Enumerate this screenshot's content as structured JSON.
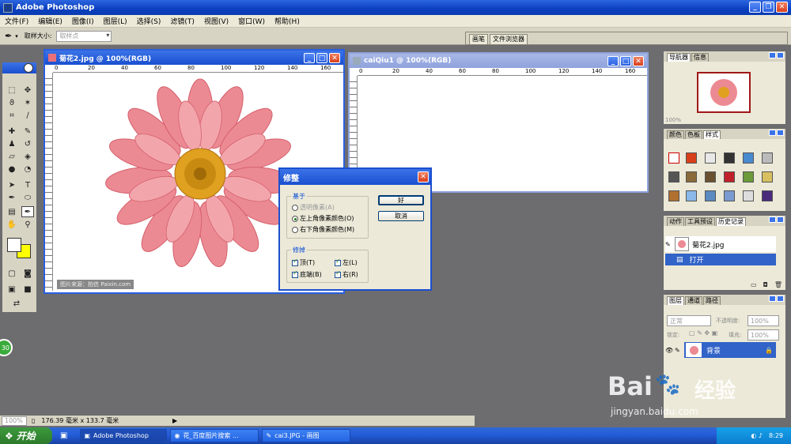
{
  "app": {
    "title": "Adobe Photoshop"
  },
  "menu": [
    "文件(F)",
    "编辑(E)",
    "图像(I)",
    "图层(L)",
    "选择(S)",
    "滤镜(T)",
    "视图(V)",
    "窗口(W)",
    "帮助(H)"
  ],
  "options": {
    "sample_label": "取样大小:",
    "sample_value": "取样点"
  },
  "wells": [
    "画笔",
    "文件浏览器"
  ],
  "doc1": {
    "title": "菊花2.jpg @ 100%(RGB)",
    "ruler_ticks": [
      "0",
      "20",
      "40",
      "60",
      "80",
      "100",
      "120",
      "140",
      "160"
    ],
    "watermark": "图片来源：拍信 Paixin.com"
  },
  "doc2": {
    "title": "caiQiu1 @ 100%(RGB)",
    "ruler_ticks": [
      "0",
      "20",
      "40",
      "60",
      "80",
      "100",
      "120",
      "140",
      "160"
    ]
  },
  "dialog": {
    "title": "修整",
    "based_on_label": "基于",
    "opt_transparent": "透明像素(A)",
    "opt_topleft": "左上角像素颜色(O)",
    "opt_bottomright": "右下角像素颜色(M)",
    "trim_label": "修掉",
    "chk_top": "顶(T)",
    "chk_left": "左(L)",
    "chk_bottom": "底端(B)",
    "chk_right": "右(R)",
    "ok": "好",
    "cancel": "取消"
  },
  "navigator": {
    "tabs": [
      "导航器",
      "信息"
    ],
    "zoom": "100%"
  },
  "color_panel": {
    "tabs": [
      "颜色",
      "色板",
      "样式"
    ]
  },
  "history": {
    "tabs": [
      "动作",
      "工具预设",
      "历史记录"
    ],
    "snapshot": "菊花2.jpg",
    "step": "打开"
  },
  "layers": {
    "tabs": [
      "图层",
      "通道",
      "路径"
    ],
    "blend": "正常",
    "opacity_label": "不透明度:",
    "opacity": "100%",
    "lock_label": "锁定:",
    "fill_label": "填充:",
    "fill": "100%",
    "layer_name": "背景"
  },
  "status": {
    "zoom": "100%",
    "size": "176.39 毫米 x 133.7 毫米"
  },
  "taskbar": {
    "start": "开始",
    "items": [
      "Adobe Photoshop",
      "花_百度图片搜索 ...",
      "cai3.JPG - 画图"
    ],
    "time": "8:29"
  },
  "baidu": {
    "logo": "Bai",
    "logo2": "du",
    "jingyan": "经验",
    "url": "jingyan.baidu.com"
  },
  "badge": "30",
  "colors": {
    "accent": "#2a5fe0",
    "workspace": "#6d6d70",
    "flower": "#e8707a"
  }
}
